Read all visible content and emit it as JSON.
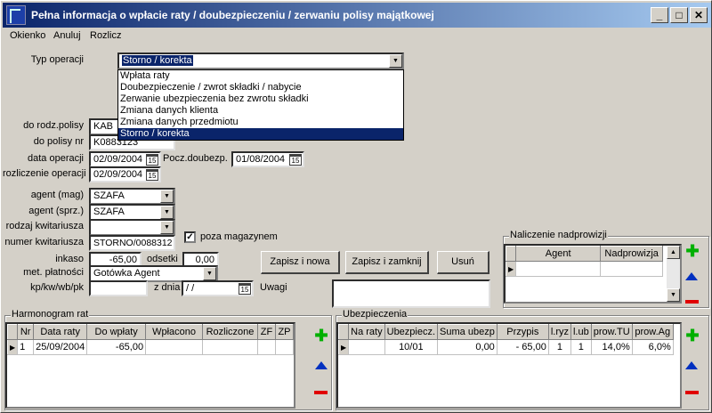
{
  "title": "Pełna informacja o wpłacie raty / doubezpieczeniu / zerwaniu polisy majątkowej",
  "window_buttons": {
    "minimize": "_",
    "maximize": "□",
    "close": "✕"
  },
  "menu": [
    "Okienko",
    "Anuluj",
    "Rozlicz"
  ],
  "form": {
    "typ_operacji_label": "Typ operacji",
    "typ_operacji_value": "Storno / korekta",
    "dropdown_options": [
      "Wpłata raty",
      "Doubezpieczenie / zwrot składki / nabycie",
      "Zerwanie ubezpieczenia bez zwrotu składki",
      "Zmiana danych klienta",
      "Zmiana danych przedmiotu",
      "Storno / korekta"
    ],
    "rodz_polisy_label": "do rodz.polisy",
    "rodz_polisy_value": "KAB",
    "polisy_nr_label": "do polisy nr",
    "polisy_nr_value": "K0883123",
    "data_operacji_label": "data operacji",
    "data_operacji_value": "02/09/2004",
    "pocz_doubezp_label": "Pocz.doubezp.",
    "pocz_doubezp_value": "01/08/2004",
    "rozliczenie_label": "rozliczenie operacji",
    "rozliczenie_value": "02/09/2004",
    "agent_mag_label": "agent (mag)",
    "agent_mag_value": "SZAFA",
    "agent_sprz_label": "agent (sprz.)",
    "agent_sprz_value": "SZAFA",
    "rodzaj_kwit_label": "rodzaj kwitariusza",
    "rodzaj_kwit_value": "",
    "numer_kwit_label": "numer kwitariusza",
    "numer_kwit_value": "STORNO/0088312",
    "poza_magazynem_label": "poza magazynem",
    "inkaso_label": "inkaso",
    "inkaso_value": "-65,00",
    "odsetki_label": "odsetki",
    "odsetki_value": "0,00",
    "met_platnosci_label": "met. płatności",
    "met_platnosci_value": "Gotówka Agent",
    "kp_label": "kp/kw/wb/pk",
    "kp_value": "",
    "z_dnia_label": "z dnia",
    "z_dnia_value": " /  /",
    "uwagi_label": "Uwagi",
    "uwagi_value": "",
    "cal_icon_text": "15"
  },
  "buttons": {
    "zapisz_nowa": "Zapisz i nowa",
    "zapisz_zamknij": "Zapisz i zamknij",
    "usun": "Usuń"
  },
  "naliczenie": {
    "title": "Naliczenie nadprowizji",
    "columns": [
      "Agent",
      "Nadprowizja"
    ]
  },
  "harmonogram": {
    "title": "Harmonogram rat",
    "columns": [
      "Nr",
      "Data raty",
      "Do wpłaty",
      "Wpłacono",
      "Rozliczone",
      "ZF",
      "ZP"
    ],
    "rows": [
      [
        "1",
        "25/09/2004",
        "-65,00",
        "",
        "",
        "",
        ""
      ]
    ]
  },
  "ubezpieczenia": {
    "title": "Ubezpieczenia",
    "columns": [
      "Na raty",
      "Ubezpiecz.",
      "Suma ubezp",
      "Przypis",
      "l.ryz",
      "l.ub",
      "prow.TU",
      "prow.Ag"
    ],
    "rows": [
      [
        "",
        "10/01",
        "0,00",
        "- 65,00",
        "1",
        "1",
        "14,0%",
        "6,0%"
      ]
    ]
  },
  "colors": {
    "title_start": "#0a246a",
    "title_end": "#a6caf0",
    "selection": "#0a246a",
    "plus": "#00b000",
    "minus": "#e00000",
    "up": "#0030c0"
  }
}
